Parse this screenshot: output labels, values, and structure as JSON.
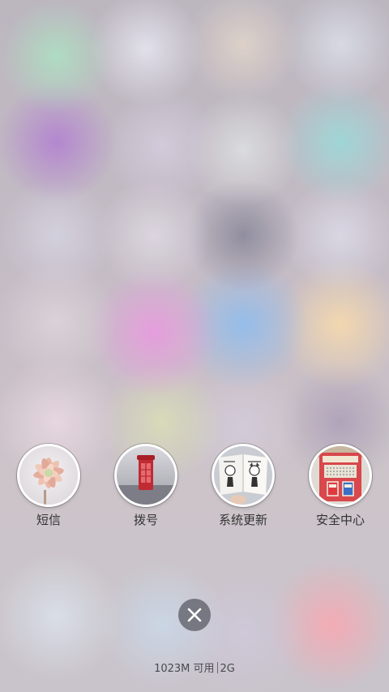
{
  "recent_apps": [
    {
      "label": "短信",
      "icon": "succulent-photo"
    },
    {
      "label": "拨号",
      "icon": "phone-booth-photo"
    },
    {
      "label": "系统更新",
      "icon": "book-photo"
    },
    {
      "label": "安全中心",
      "icon": "police-box-photo"
    }
  ],
  "close_button": {
    "icon": "close-icon"
  },
  "status": {
    "memory": "1023M 可用",
    "network": "2G"
  },
  "colors": {
    "close_button_bg": "#5f5f69",
    "label_text": "#333333",
    "thumb_border": "#ffffff"
  }
}
